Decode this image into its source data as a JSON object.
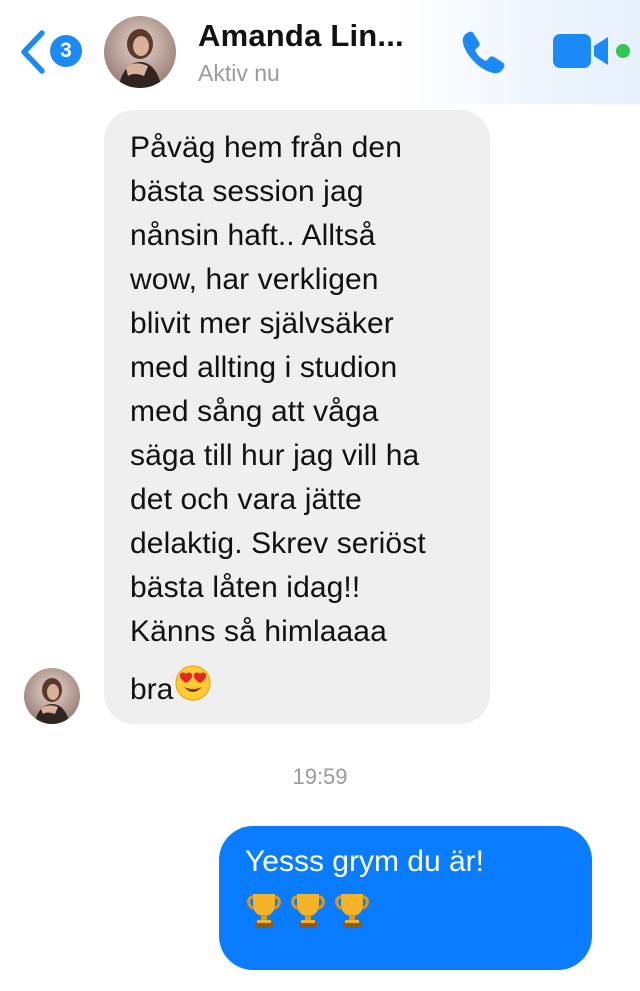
{
  "header": {
    "back_badge_count": "3",
    "contact_name": "Amanda Lin...",
    "contact_status": "Aktiv nu",
    "icons": {
      "back": "chevron-left-icon",
      "call": "phone-icon",
      "video": "video-camera-icon",
      "online": "online-dot"
    }
  },
  "messages": {
    "incoming": {
      "text": "Påväg hem från den\nbästa session jag\nnånsin haft.. Alltså\nwow, har verkligen\nblivit mer självsäker\nmed allting i studion\nmed sång att våga\nsäga till hur jag vill ha\ndet och vara jätte\ndelaktig. Skrev seriöst\nbästa låten idag!!\nKänns så himlaaaa",
      "last_word": "bra",
      "emoji": "heart-eyes-emoji"
    },
    "timestamp": "19:59",
    "outgoing": {
      "text": "Yesss grym du är!",
      "emoji": [
        "trophy-emoji",
        "trophy-emoji",
        "trophy-emoji"
      ]
    }
  },
  "colors": {
    "accent": "#0a7cff",
    "incoming_bubble": "#efefef",
    "online": "#31c552",
    "muted_text": "#9a9a9e"
  }
}
